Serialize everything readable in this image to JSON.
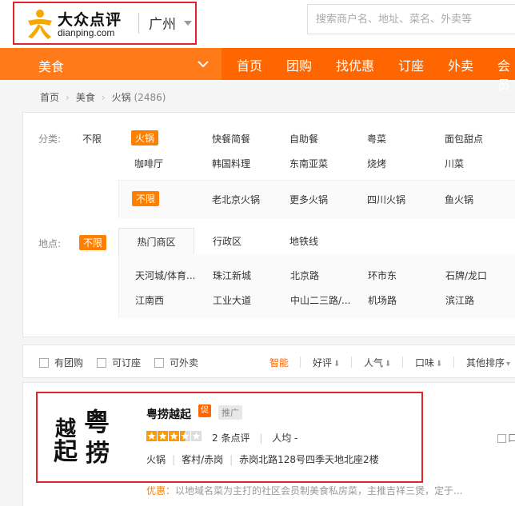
{
  "header": {
    "logo_cn": "大众点评",
    "logo_en": "dianping.com",
    "city": "广州",
    "search_placeholder": "搜索商户名、地址、菜名、外卖等"
  },
  "nav": {
    "category": "美食",
    "items": [
      "首页",
      "团购",
      "找优惠",
      "订座",
      "外卖",
      "会员"
    ]
  },
  "breadcrumb": {
    "items": [
      "首页",
      "美食",
      "火锅"
    ],
    "count": "(2486)"
  },
  "filters": {
    "category_label": "分类:",
    "category_all": "不限",
    "categories": [
      "火锅",
      "快餐简餐",
      "自助餐",
      "粤菜",
      "面包甜点",
      "咖啡厅",
      "韩国料理",
      "东南亚菜",
      "烧烤",
      "川菜"
    ],
    "subcategories": [
      "不限",
      "老北京火锅",
      "更多火锅",
      "四川火锅",
      "鱼火锅"
    ],
    "location_label": "地点:",
    "location_all": "不限",
    "location_tabs": [
      "热门商区",
      "行政区",
      "地铁线"
    ],
    "areas": [
      "天河城/体育...",
      "珠江新城",
      "北京路",
      "环市东",
      "石牌/龙口",
      "江南西",
      "工业大道",
      "中山二三路/...",
      "机场路",
      "滨江路"
    ]
  },
  "sortbar": {
    "checks": [
      "有团购",
      "可订座",
      "可外卖"
    ],
    "sorts": [
      "智能",
      "好评",
      "人气",
      "口味",
      "其他排序"
    ]
  },
  "result": {
    "name": "粤捞越起",
    "badge_cu": "促",
    "badge_ad": "推广",
    "rating_stars": 3.5,
    "review_count": "2",
    "review_suffix": "条点评",
    "avg_price": "人均 -",
    "cuisine": "火锅",
    "district": "客村/赤岗",
    "address": "赤岗北路128号四季天地北座2楼",
    "promo_label": "优惠：",
    "promo_text": "以地域名菜为主打的社区会员制美食私房菜，主推吉祥三煲，定于...",
    "right_check": "口味",
    "logo_text_1": "越",
    "logo_text_2": "粤",
    "logo_text_3": "起",
    "logo_text_4": "捞"
  },
  "colors": {
    "accent": "#ff6600",
    "highlight": "#e0242b",
    "tag": "#ff8000"
  }
}
